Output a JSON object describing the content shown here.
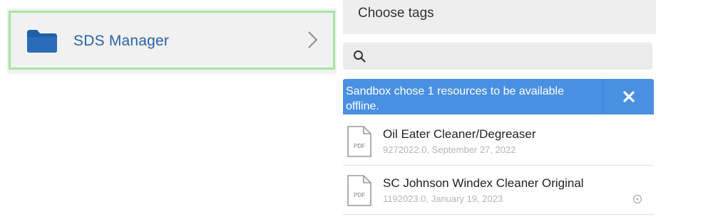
{
  "folder_list": {
    "items": [
      {
        "label": "SDS Manager",
        "icon": "folder-icon",
        "highlighted": true
      }
    ]
  },
  "tags_panel": {
    "header": "Choose tags",
    "search": {
      "value": "",
      "placeholder": ""
    },
    "banner": {
      "message": "Sandbox chose 1 resources to be available offline.",
      "close_icon": "close-icon"
    },
    "resources": [
      {
        "title": "Oil Eater Cleaner/Degreaser",
        "meta": "9272022.0, September 27, 2022",
        "icon": "pdf-file-icon",
        "badge": "PDF"
      },
      {
        "title": "SC Johnson Windex Cleaner Original",
        "meta": "1192023.0, January 19, 2023",
        "icon": "pdf-file-icon",
        "badge": "PDF",
        "status_icon": "clock-icon"
      }
    ]
  },
  "colors": {
    "accent_blue": "#4a90e2",
    "folder_blue": "#2a62a8",
    "selection_green": "#a5e6a1",
    "header_gray": "#eeeeee"
  }
}
